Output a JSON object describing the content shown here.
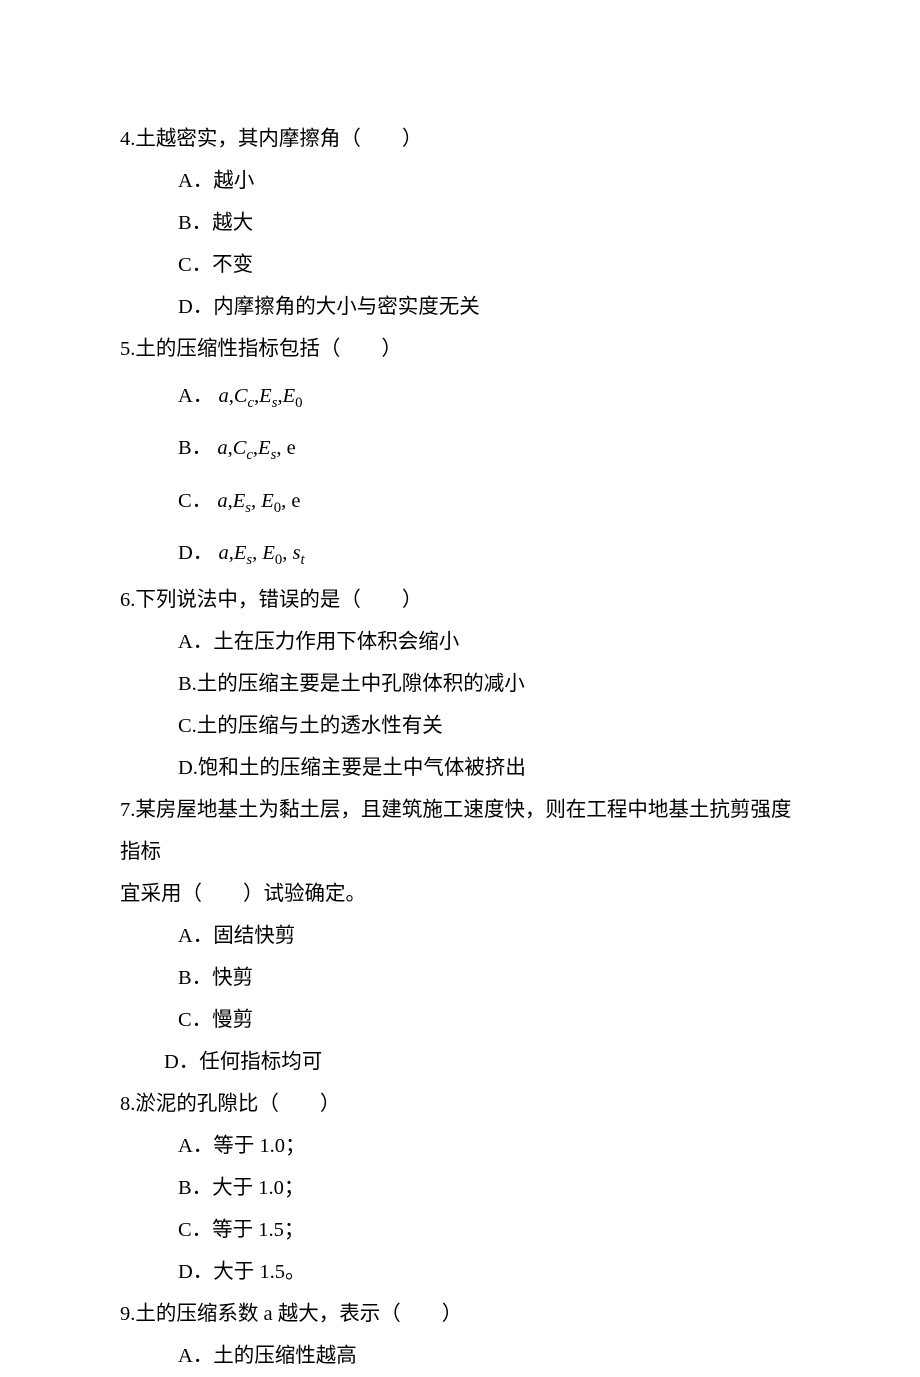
{
  "q4": {
    "stem": "4.土越密实，其内摩擦角（　　）",
    "A": "A．越小",
    "B": "B．越大",
    "C": "C．不变",
    "D": "D．内摩擦角的大小与密实度无关"
  },
  "q5": {
    "stem": "5.土的压缩性指标包括（　　）",
    "A_prefix": "A．",
    "A_math": "a, C_c, E_s, E_0",
    "B_prefix": "B．",
    "B_math": "a, C_c, E_s, e",
    "C_prefix": "C．",
    "C_math": "a, E_s, E_0, e",
    "D_prefix": "D．",
    "D_math": "a, E_s, E_0, s_t"
  },
  "q6": {
    "stem": "6.下列说法中，错误的是（　　）",
    "A": "A．土在压力作用下体积会缩小",
    "B": "B.土的压缩主要是土中孔隙体积的减小",
    "C": "C.土的压缩与土的透水性有关",
    "D": "D.饱和土的压缩主要是土中气体被挤出"
  },
  "q7": {
    "stem1": "7.某房屋地基土为黏土层，且建筑施工速度快，则在工程中地基土抗剪强度指标",
    "stem2": "宜采用（　　）试验确定。",
    "A": "A．固结快剪",
    "B": "B．快剪",
    "C": "C．慢剪",
    "D": "D．任何指标均可"
  },
  "q8": {
    "stem": "8.淤泥的孔隙比（　　）",
    "A": "A．等于 1.0；",
    "B": "B．大于 1.0；",
    "C": "C．等于 1.5；",
    "D": "D．大于 1.5。"
  },
  "q9": {
    "stem": "9.土的压缩系数 a 越大，表示（　　）",
    "A": "A．土的压缩性越高"
  }
}
